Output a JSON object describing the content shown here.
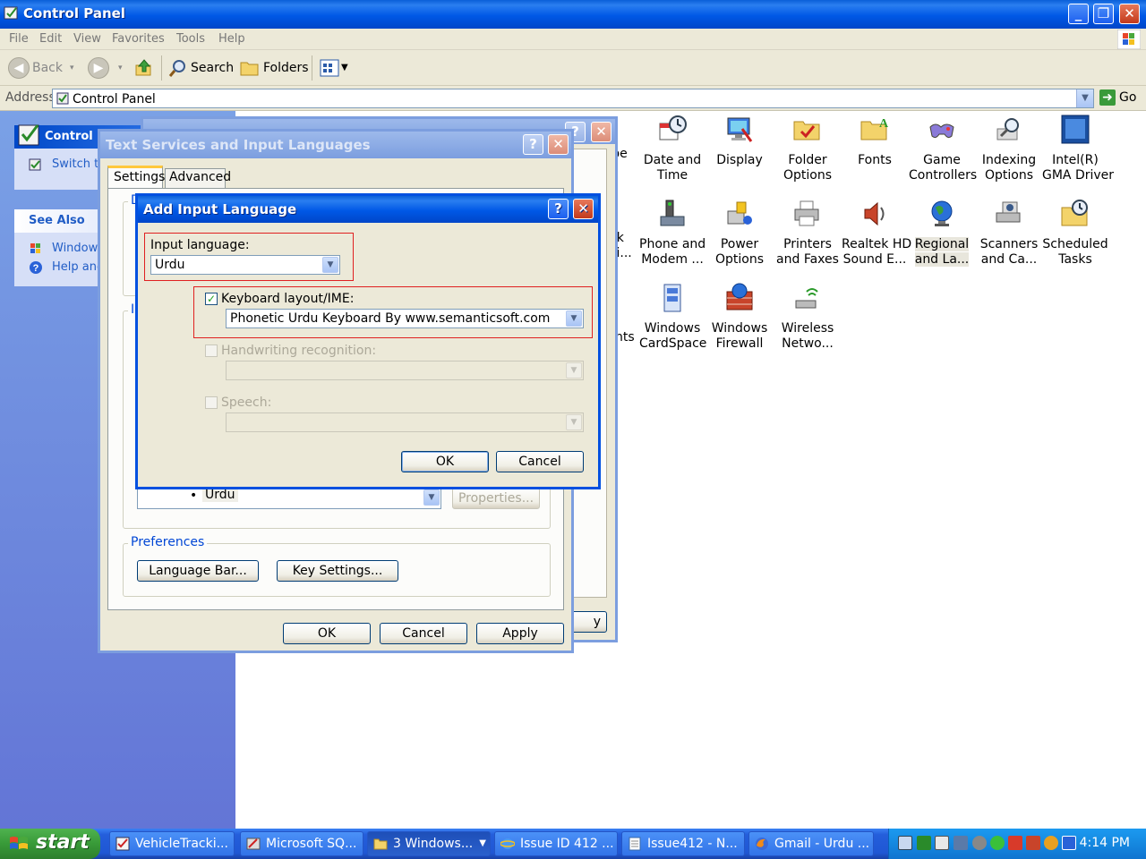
{
  "window": {
    "title": "Control Panel",
    "minimize": "_",
    "maximize": "❐",
    "close": "✕"
  },
  "menu": [
    "File",
    "Edit",
    "View",
    "Favorites",
    "Tools",
    "Help"
  ],
  "toolbar": {
    "back": "Back",
    "search": "Search",
    "folders": "Folders"
  },
  "address": {
    "label": "Address",
    "value": "Control Panel",
    "go": "Go"
  },
  "taskpane": {
    "control_panel_header": "Control P",
    "switch_link": "Switch to",
    "see_also_header": "See Also",
    "see_also_items": [
      "Windows",
      "Help and"
    ]
  },
  "control_panel_items": [
    {
      "label": "ype\ng"
    },
    {
      "label": "Date and\nTime"
    },
    {
      "label": "Display"
    },
    {
      "label": "Folder\nOptions"
    },
    {
      "label": "Fonts"
    },
    {
      "label": "Game\nControllers"
    },
    {
      "label": "Indexing\nOptions"
    },
    {
      "label": "Intel(R)\nGMA Driver"
    },
    {
      "label": "rk\nti..."
    },
    {
      "label": "Phone and\nModem ..."
    },
    {
      "label": "Power\nOptions"
    },
    {
      "label": "Printers\nand Faxes"
    },
    {
      "label": "Realtek HD\nSound E..."
    },
    {
      "label": "Regional\nand La..."
    },
    {
      "label": "Scanners\nand Ca..."
    },
    {
      "label": "Scheduled\nTasks"
    },
    {
      "label": "nts"
    },
    {
      "label": "Windows\nCardSpace"
    },
    {
      "label": "Windows\nFirewall"
    },
    {
      "label": "Wireless\nNetwo..."
    }
  ],
  "regional_dialog": {
    "help": "?",
    "close": "✕",
    "partial_button": "y"
  },
  "text_services_dialog": {
    "title": "Text Services and Input Languages",
    "help": "?",
    "close": "✕",
    "tabs": [
      "Settings",
      "Advanced"
    ],
    "group_d_label": "D",
    "group_i_label": "I",
    "installed_item": "Urdu",
    "properties_button": "Properties...",
    "preferences_label": "Preferences",
    "language_bar_button": "Language Bar...",
    "key_settings_button": "Key Settings...",
    "ok": "OK",
    "cancel": "Cancel",
    "apply": "Apply"
  },
  "add_input_language_dialog": {
    "title": "Add Input Language",
    "help": "?",
    "close": "✕",
    "input_language_label": "Input language:",
    "input_language_value": "Urdu",
    "keyboard_label": "Keyboard layout/IME:",
    "keyboard_checked": true,
    "keyboard_value": "Phonetic Urdu Keyboard By www.semanticsoft.com",
    "handwriting_label": "Handwriting recognition:",
    "speech_label": "Speech:",
    "ok": "OK",
    "cancel": "Cancel"
  },
  "taskbar": {
    "start": "start",
    "items": [
      "VehicleTracki...",
      "Microsoft SQ...",
      "3 Windows...",
      "Issue ID 412 ...",
      "Issue412 - N...",
      "Gmail - Urdu ..."
    ],
    "clock": "4:14 PM"
  },
  "colors": {
    "xp_blue": "#0058e6",
    "dialog_bg": "#ece9d8",
    "highlight_box": "#e02020",
    "taskpane_blue": "#6f8fe0",
    "start_green": "#389a38"
  }
}
